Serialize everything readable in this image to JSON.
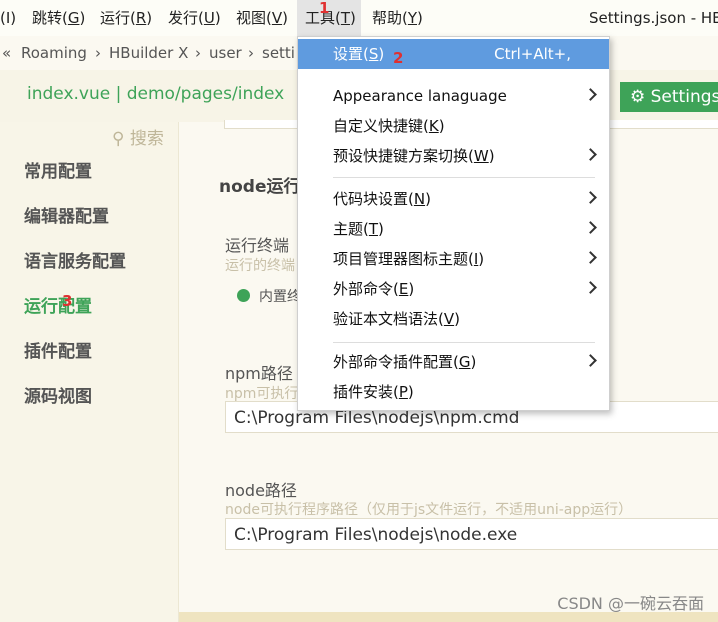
{
  "menubar": {
    "items": [
      {
        "label": "(I)",
        "mnemonic": "",
        "suffix": ""
      },
      {
        "label": "跳转(",
        "mnemonic": "G",
        "suffix": ")"
      },
      {
        "label": "运行(",
        "mnemonic": "R",
        "suffix": ")"
      },
      {
        "label": "发行(",
        "mnemonic": "U",
        "suffix": ")"
      },
      {
        "label": "视图(",
        "mnemonic": "V",
        "suffix": ")"
      },
      {
        "label": "工具(",
        "mnemonic": "T",
        "suffix": ")"
      },
      {
        "label": "帮助(",
        "mnemonic": "Y",
        "suffix": ")"
      }
    ],
    "annotation_1": "1",
    "window_title": "Settings.json - HB"
  },
  "breadcrumb": {
    "items": [
      "«",
      "Roaming",
      "›",
      "HBuilder X",
      "›",
      "user",
      "›",
      "setti"
    ]
  },
  "tabs": {
    "file_tab": "index.vue | demo/pages/index",
    "settings_icon": "gear-icon",
    "settings_tab": "⚙ Settings."
  },
  "sidebar": {
    "search": "⚲ 搜索",
    "items": [
      "常用配置",
      "编辑器配置",
      "语言服务配置",
      "运行配置",
      "插件配置",
      "源码视图"
    ],
    "annotation_3": "3"
  },
  "main": {
    "section_title": "node运行",
    "terminal_label": "运行终端",
    "terminal_hint": "运行的终端",
    "terminal_option": "内置终",
    "npm_label": "npm路径",
    "npm_hint": "npm可执行",
    "npm_value": "C:\\Program Files\\nodejs\\npm.cmd",
    "node_label": "node路径",
    "node_hint": "node可执行程序路径（仅用于js文件运行，不适用uni-app运行）",
    "node_value": "C:\\Program Files\\nodejs\\node.exe"
  },
  "dropdown": {
    "items": [
      {
        "label": "设置(",
        "mnemonic": "S",
        "suffix": ")",
        "shortcut": "Ctrl+Alt+,",
        "submenu": false
      },
      {
        "label": "Appearance lanaguage",
        "mnemonic": "",
        "suffix": "",
        "shortcut": "",
        "submenu": true
      },
      {
        "label": "自定义快捷键(",
        "mnemonic": "K",
        "suffix": ")",
        "shortcut": "",
        "submenu": false
      },
      {
        "label": "预设快捷键方案切换(",
        "mnemonic": "W",
        "suffix": ")",
        "shortcut": "",
        "submenu": true
      },
      {
        "label": "代码块设置(",
        "mnemonic": "N",
        "suffix": ")",
        "shortcut": "",
        "submenu": true
      },
      {
        "label": "主题(",
        "mnemonic": "T",
        "suffix": ")",
        "shortcut": "",
        "submenu": true
      },
      {
        "label": "项目管理器图标主题(",
        "mnemonic": "I",
        "suffix": ")",
        "shortcut": "",
        "submenu": true
      },
      {
        "label": "外部命令(",
        "mnemonic": "E",
        "suffix": ")",
        "shortcut": "",
        "submenu": true
      },
      {
        "label": "验证本文档语法(",
        "mnemonic": "V",
        "suffix": ")",
        "shortcut": "",
        "submenu": false
      },
      {
        "label": "外部命令插件配置(",
        "mnemonic": "G",
        "suffix": ")",
        "shortcut": "",
        "submenu": true
      },
      {
        "label": "插件安装(",
        "mnemonic": "P",
        "suffix": ")",
        "shortcut": "",
        "submenu": false
      }
    ],
    "annotation_2": "2"
  },
  "watermark": "CSDN @一碗云吞面",
  "colors": {
    "accent": "#3ea358",
    "highlight": "#5f9bdf",
    "annotation": "#e03030"
  }
}
